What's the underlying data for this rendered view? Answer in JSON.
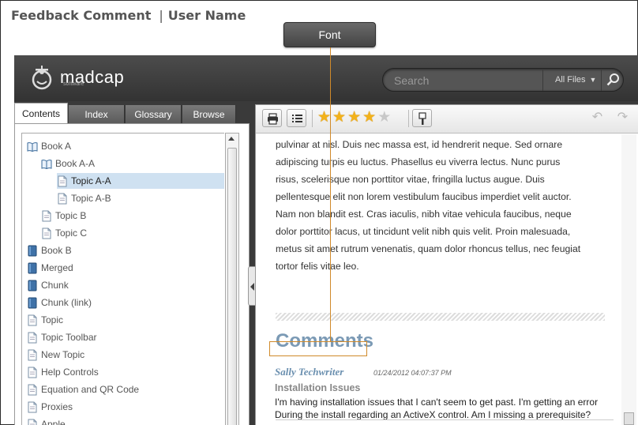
{
  "callout": {
    "title": "Feedback Comment",
    "separator": "|",
    "subtitle": "User Name",
    "font_label": "Font"
  },
  "header": {
    "brand": "madcap",
    "brand_sub": "software",
    "search_placeholder": "Search",
    "filter_label": "All Files",
    "filter_caret": "▼"
  },
  "tabs": [
    {
      "label": "Contents",
      "active": true
    },
    {
      "label": "Index",
      "active": false
    },
    {
      "label": "Glossary",
      "active": false
    },
    {
      "label": "Browse",
      "active": false
    }
  ],
  "toc": [
    {
      "label": "Book A",
      "type": "book-open"
    },
    {
      "label": "Book A-A",
      "type": "book-open"
    },
    {
      "label": "Topic A-A",
      "type": "topic",
      "selected": true
    },
    {
      "label": "Topic A-B",
      "type": "topic"
    },
    {
      "label": "Topic B",
      "type": "topic"
    },
    {
      "label": "Topic C",
      "type": "topic"
    },
    {
      "label": "Book B",
      "type": "book"
    },
    {
      "label": "Merged",
      "type": "book"
    },
    {
      "label": "Chunk",
      "type": "book"
    },
    {
      "label": "Chunk (link)",
      "type": "book"
    },
    {
      "label": "Topic",
      "type": "topic"
    },
    {
      "label": "Topic Toolbar",
      "type": "topic"
    },
    {
      "label": "New Topic",
      "type": "topic"
    },
    {
      "label": "Help Controls",
      "type": "topic"
    },
    {
      "label": "Equation and QR Code",
      "type": "topic"
    },
    {
      "label": "Proxies",
      "type": "topic"
    },
    {
      "label": "Apple",
      "type": "topic"
    }
  ],
  "rating": {
    "value": 4,
    "max": 5
  },
  "colors": {
    "accent": "#7b9ab5",
    "callout": "#d08a2a",
    "star": "#f3b21a"
  },
  "article": {
    "lines": [
      "pulvinar at nisl. Duis nec massa est, id hendrerit neque. Sed ornare",
      "adipiscing turpis eu luctus. Phasellus eu viverra lectus. Nunc purus",
      "risus, scelerisque non porttitor vitae, fringilla luctus augue. Duis",
      "pellentesque elit non lorem vestibulum faucibus imperdiet velit auctor.",
      "Nam non blandit est. Cras iaculis, nibh vitae vehicula faucibus, neque",
      "dolor porttitor lacus, ut tincidunt velit nibh quis velit. Proin malesuada,",
      "metus sit amet rutrum venenatis, quam dolor rhoncus tellus, nec feugiat",
      "tortor felis vitae leo."
    ]
  },
  "comments": {
    "heading": "Comments",
    "author": "Sally Techwriter",
    "date": "01/24/2012 04:07:37 PM",
    "subject": "Installation Issues",
    "body": "I'm having installation issues that I can't seem to get past. I'm getting an error During the install regarding an ActiveX control. Am I missing a prerequisite?"
  }
}
